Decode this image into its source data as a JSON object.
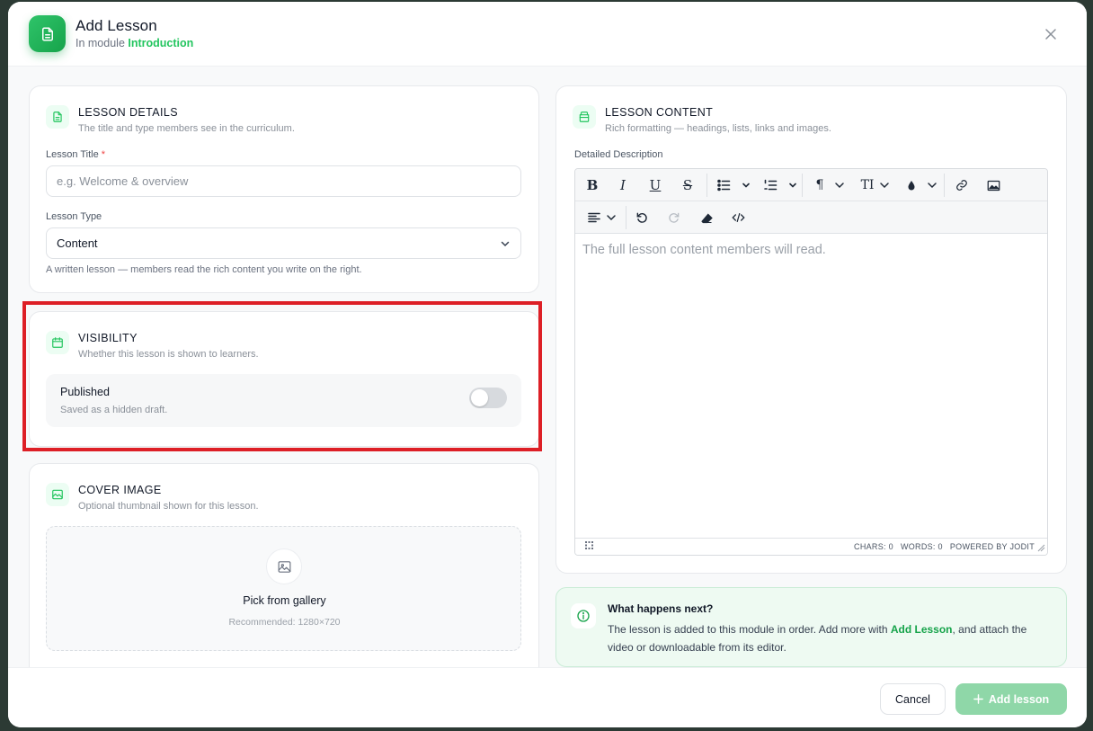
{
  "header": {
    "title": "Add Lesson",
    "subtitle_prefix": "In module",
    "module_name": "Introduction",
    "badge_icon": "document-icon",
    "close_icon": "close-icon"
  },
  "lesson_details": {
    "title": "LESSON DETAILS",
    "description": "The title and type members see in the curriculum.",
    "title_label": "Lesson Title",
    "required_mark": "*",
    "title_value": "",
    "title_placeholder": "e.g. Welcome & overview",
    "type_label": "Lesson Type",
    "type_value": "Content",
    "type_hint": "A written lesson — members read the rich content you write on the right."
  },
  "visibility": {
    "title": "VISIBILITY",
    "description": "Whether this lesson is shown to learners.",
    "toggle_label": "Published",
    "toggle_sub": "Saved as a hidden draft.",
    "published": false
  },
  "cover_image": {
    "title": "COVER IMAGE",
    "description": "Optional thumbnail shown for this lesson.",
    "pick_label": "Pick from gallery",
    "recommended": "Recommended: 1280×720"
  },
  "lesson_content": {
    "title": "LESSON CONTENT",
    "description": "Rich formatting — headings, lists, links and images.",
    "field_label": "Detailed Description",
    "placeholder": "The full lesson content members will read.",
    "status": {
      "chars": "CHARS: 0",
      "words": "WORDS: 0",
      "powered": "POWERED BY JODIT"
    }
  },
  "info": {
    "title": "What happens next?",
    "text_before": "The lesson is added to this module in order. Add more with ",
    "link": "Add Lesson",
    "text_after": ", and attach the video or downloadable from its editor."
  },
  "footer": {
    "cancel_label": "Cancel",
    "add_label": "Add lesson"
  },
  "colors": {
    "brand": "#22c55e",
    "highlight": "#dd1f26",
    "add_button": "#8fd7a8"
  }
}
